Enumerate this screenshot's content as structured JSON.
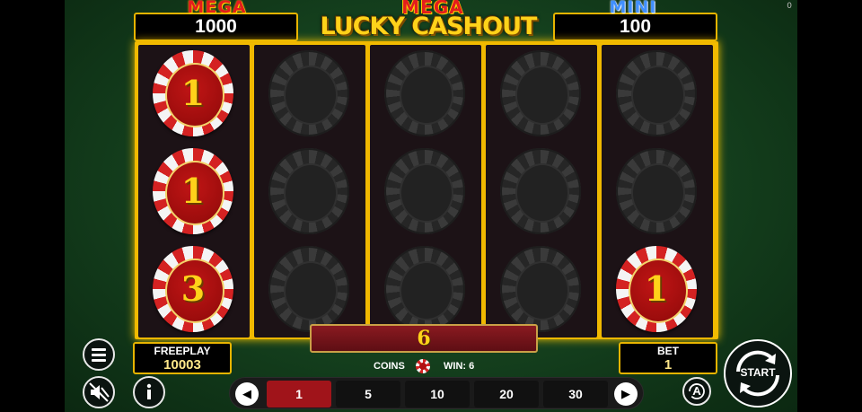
{
  "corner_label": "0",
  "jackpots": {
    "left": {
      "title": "MEGA",
      "value": "1000"
    },
    "right": {
      "title": "MINI",
      "value": "100"
    }
  },
  "logo": {
    "top": "MEGA",
    "main": "LUCKY CASHOUT"
  },
  "reels": [
    [
      {
        "type": "coin",
        "value": "1"
      },
      {
        "type": "coin",
        "value": "1"
      },
      {
        "type": "coin",
        "value": "3"
      }
    ],
    [
      {
        "type": "empty"
      },
      {
        "type": "empty"
      },
      {
        "type": "empty"
      }
    ],
    [
      {
        "type": "empty"
      },
      {
        "type": "empty"
      },
      {
        "type": "empty"
      }
    ],
    [
      {
        "type": "empty"
      },
      {
        "type": "empty"
      },
      {
        "type": "empty"
      }
    ],
    [
      {
        "type": "empty"
      },
      {
        "type": "empty"
      },
      {
        "type": "coin",
        "value": "1"
      }
    ]
  ],
  "total_win": "6",
  "freeplay": {
    "label": "FREEPLAY",
    "value": "10003"
  },
  "bet": {
    "label": "BET",
    "value": "1"
  },
  "coins": {
    "label": "COINS",
    "win_label": "WIN: 6"
  },
  "bet_options": [
    {
      "label": "1",
      "active": true
    },
    {
      "label": "5",
      "active": false
    },
    {
      "label": "10",
      "active": false
    },
    {
      "label": "20",
      "active": false
    },
    {
      "label": "30",
      "active": false
    }
  ],
  "start_label": "START",
  "icons": {
    "menu": "menu-icon",
    "mute": "speaker-muted-icon",
    "info": "info-icon",
    "prev": "chevron-left-icon",
    "next": "chevron-right-icon",
    "auto": "autoplay-icon",
    "start": "refresh-arrows-icon"
  },
  "colors": {
    "accent": "#f0b800",
    "active_bet": "#a0141a",
    "felt": "#1f5a2a"
  }
}
